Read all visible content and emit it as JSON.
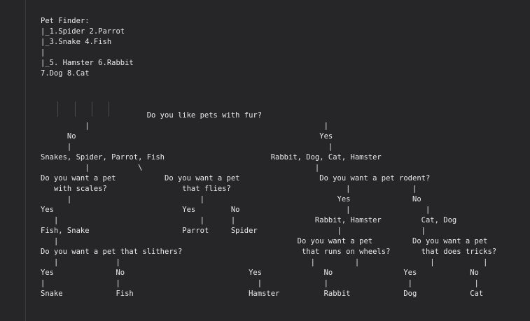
{
  "editor": {
    "lines": [
      "Pet Finder:",
      "|_1.Spider 2.Parrot",
      "|_3.Snake 4.Fish",
      "|",
      "|_5. Hamster 6.Rabbit",
      "7.Dog 8.Cat",
      "",
      "",
      "",
      "                        Do you like pets with fur?",
      "          |                                                     |",
      "      No                                                       Yes",
      "      |                                                          |",
      "Snakes, Spider, Parrot, Fish                        Rabbit, Dog, Cat, Hamster",
      "          |           \\                                       |",
      "Do you want a pet           Do you want a pet                  Do you want a pet rodent?",
      "   with scales?                 that flies?                          |              |",
      "      |                             |                              Yes              No",
      "Yes                             Yes        No                        |                 |",
      "   |                                |      |                  Rabbit, Hamster         Cat, Dog",
      "Fish, Snake                     Parrot     Spider                  |                  |",
      "   |                                                      Do you want a pet         Do you want a pet",
      "Do you want a pet that slithers?                           that runs on wheels?       that does tricks?",
      "   |             |                                           |         |                |           |",
      "Yes              No                            Yes              No                Yes            No",
      "|                |                               |              |                  |              |",
      "Snake            Fish                          Hamster          Rabbit            Dog            Cat"
    ]
  }
}
